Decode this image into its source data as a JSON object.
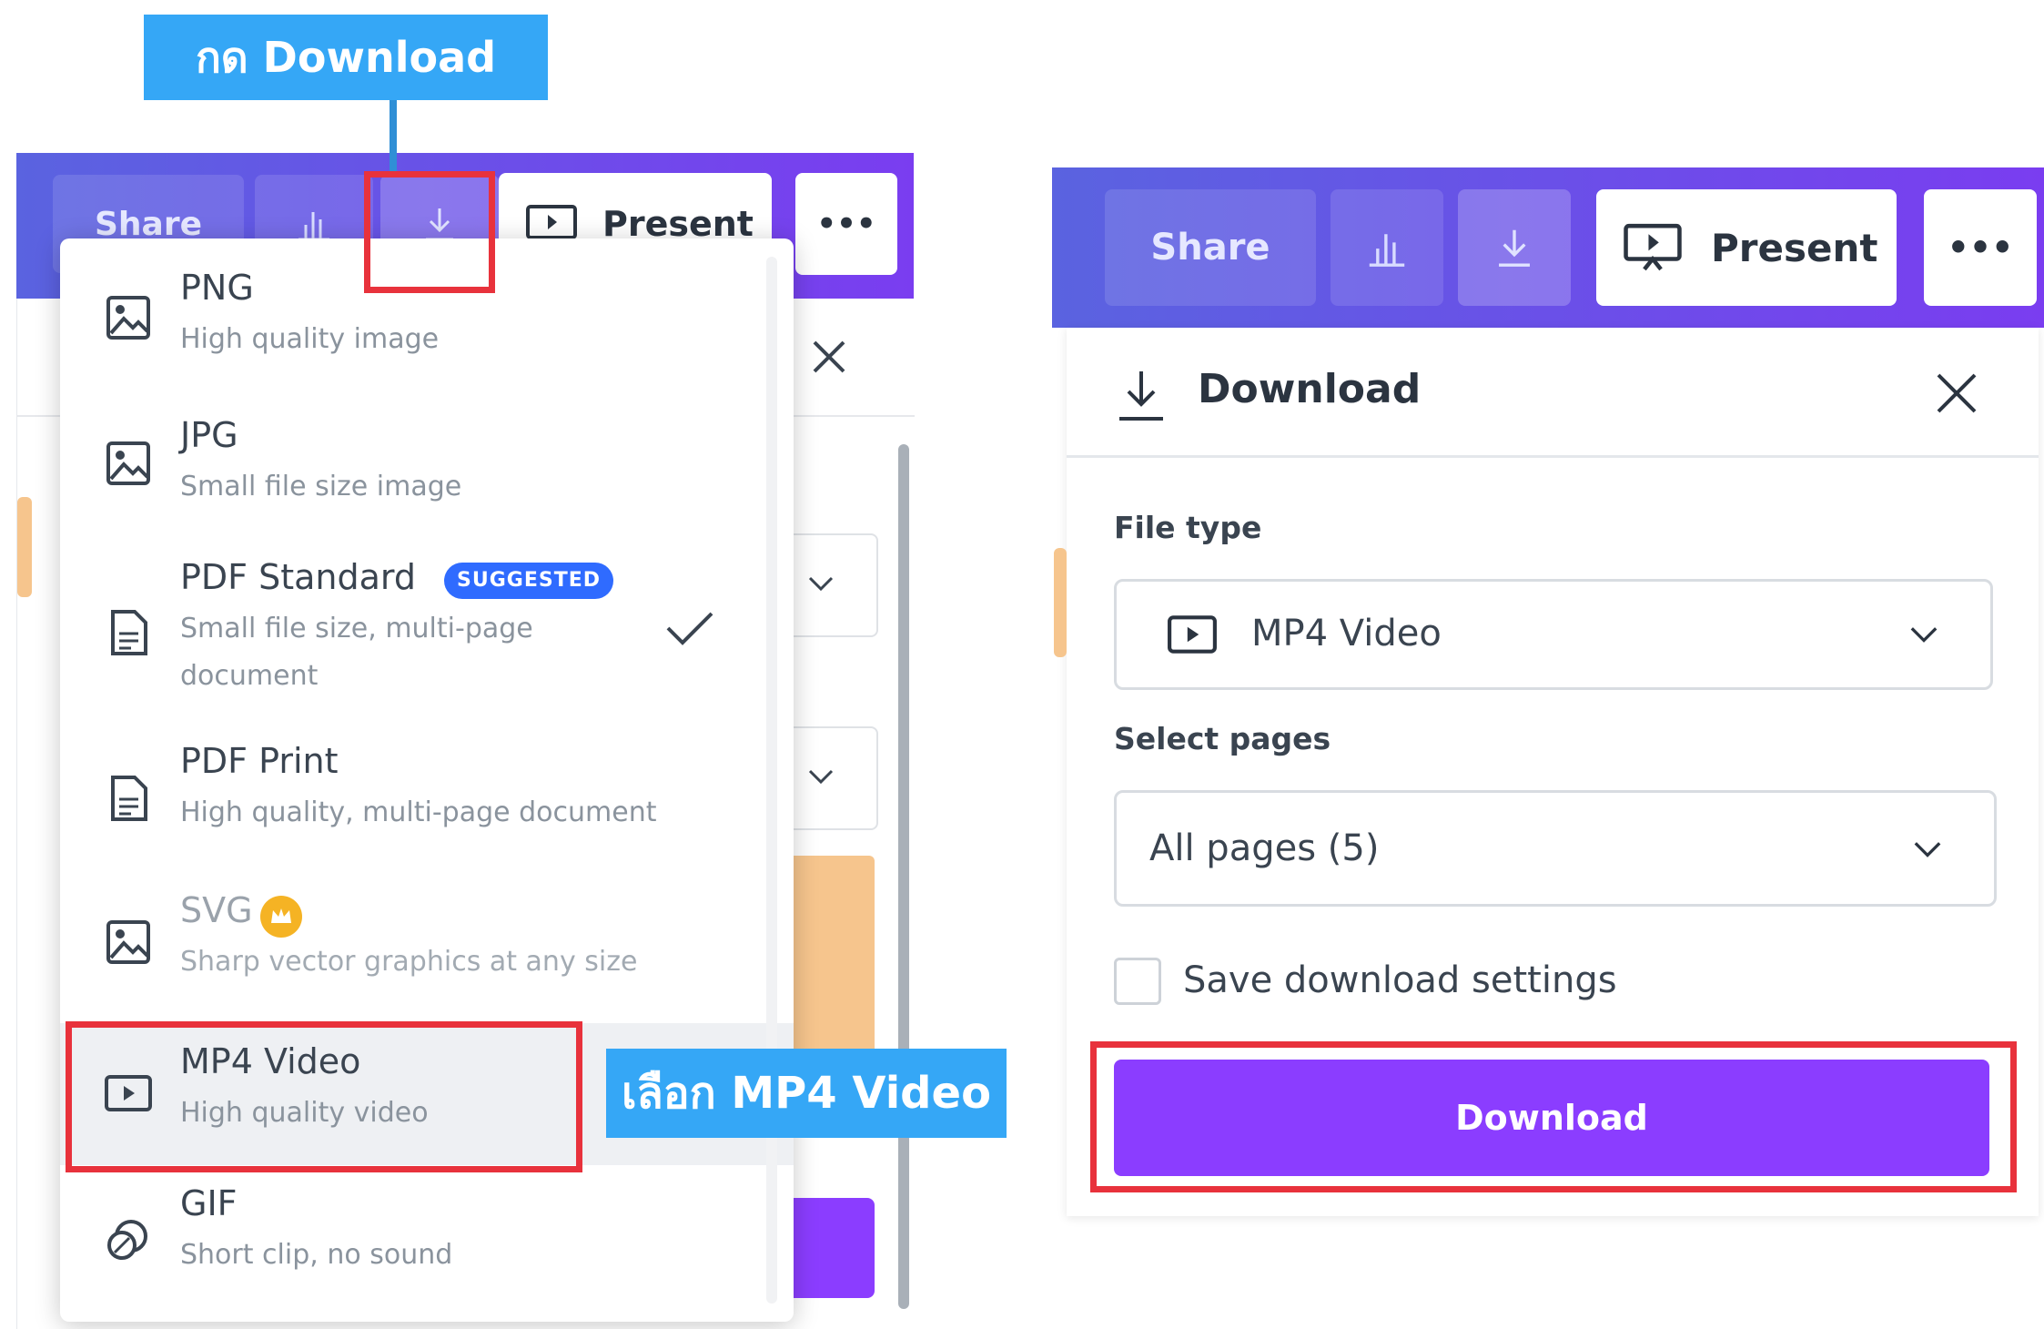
{
  "annotations": {
    "click_download": "กด Download",
    "choose_mp4": "เลือก MP4 Video"
  },
  "left_toolbar": {
    "share_label": "Share",
    "present_label": "Present",
    "more_label": "•••"
  },
  "right_toolbar": {
    "share_label": "Share",
    "present_label": "Present",
    "more_label": "•••"
  },
  "file_type_menu": {
    "items": [
      {
        "title": "PNG",
        "subtitle": "High quality image",
        "icon": "image-icon"
      },
      {
        "title": "JPG",
        "subtitle": "Small file size image",
        "icon": "image-icon"
      },
      {
        "title": "PDF Standard",
        "badge": "SUGGESTED",
        "subtitle": "Small file size, multi-page",
        "subtitle2": "document",
        "icon": "document-icon",
        "selected": true
      },
      {
        "title": "PDF Print",
        "subtitle": "High quality, multi-page document",
        "icon": "document-icon"
      },
      {
        "title": "SVG",
        "subtitle": "Sharp vector graphics at any size",
        "icon": "image-icon",
        "premium": true
      },
      {
        "title": "MP4 Video",
        "subtitle": "High quality video",
        "icon": "video-icon",
        "highlighted": true
      },
      {
        "title": "GIF",
        "subtitle": "Short clip, no sound",
        "icon": "gif-icon"
      }
    ]
  },
  "download_panel": {
    "title": "Download",
    "file_type_label": "File type",
    "file_type_value": "MP4 Video",
    "select_pages_label": "Select pages",
    "select_pages_value": "All pages (5)",
    "save_settings_label": "Save download settings",
    "save_settings_checked": false,
    "download_button": "Download"
  },
  "colors": {
    "toolbar_start": "#5a63e0",
    "toolbar_end": "#7a3df0",
    "primary": "#8b3dff",
    "callout": "#35a7f6",
    "highlight_border": "#e8323c",
    "badge": "#2f6bff"
  }
}
